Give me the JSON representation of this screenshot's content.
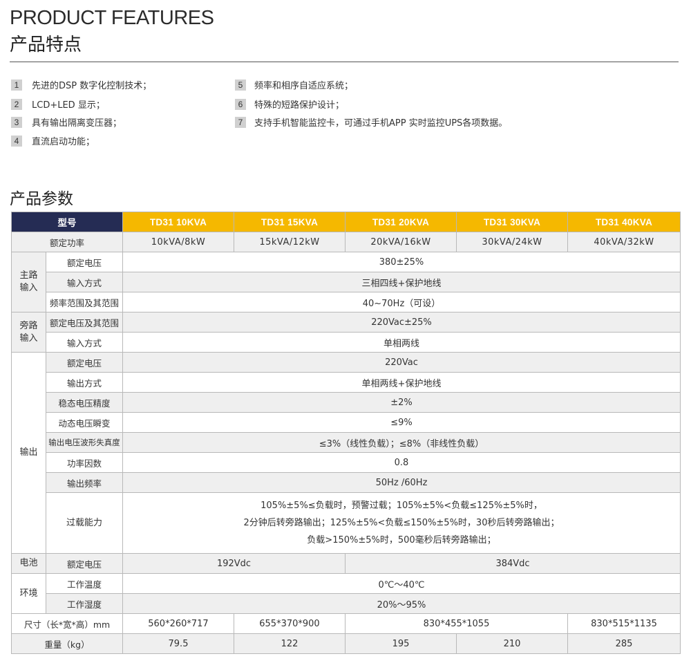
{
  "header": {
    "title_en": "PRODUCT FEATURES",
    "title_cn": "产品特点"
  },
  "features_left": [
    {
      "num": "1",
      "text": "先进的DSP 数字化控制技术；"
    },
    {
      "num": "2",
      "text": "LCD+LED 显示；"
    },
    {
      "num": "3",
      "text": "具有输出隔离变压器；"
    },
    {
      "num": "4",
      "text": "直流启动功能；"
    }
  ],
  "features_right": [
    {
      "num": "5",
      "text": "频率和相序自适应系统；"
    },
    {
      "num": "6",
      "text": "特殊的短路保护设计；"
    },
    {
      "num": "7",
      "text": "支持手机智能监控卡，可通过手机APP  实时监控UPS各项数据。"
    }
  ],
  "params_title": "产品参数",
  "table": {
    "model_label": "型号",
    "models": [
      "TD31 10KVA",
      "TD31 15KVA",
      "TD31 20KVA",
      "TD31 30KVA",
      "TD31 40KVA"
    ],
    "rated_power_label": "额定功率",
    "rated_power": [
      "10kVA/8kW",
      "15kVA/12kW",
      "20kVA/16kW",
      "30kVA/24kW",
      "40kVA/32kW"
    ],
    "main_input": {
      "group": "主路输入",
      "rows": [
        {
          "label": "额定电压",
          "value": "380±25%"
        },
        {
          "label": "输入方式",
          "value": "三相四线+保护地线"
        },
        {
          "label": "频率范围及其范围",
          "value": "40~70Hz（可设）"
        }
      ]
    },
    "bypass_input": {
      "group": "旁路输入",
      "rows": [
        {
          "label": "额定电压及其范围",
          "value": "220Vac±25%"
        },
        {
          "label": "输入方式",
          "value": "单相两线"
        }
      ]
    },
    "output": {
      "group": "输出",
      "rows": [
        {
          "label": "额定电压",
          "value": "220Vac"
        },
        {
          "label": "输出方式",
          "value": "单相两线+保护地线"
        },
        {
          "label": "稳态电压精度",
          "value": "±2%"
        },
        {
          "label": "动态电压瞬变",
          "value": "≤9%"
        },
        {
          "label": "输出电压波形失真度",
          "value": "≤3%（线性负载）；≤8%（非线性负载）"
        },
        {
          "label": "功率因数",
          "value": "0.8"
        },
        {
          "label": "输出频率",
          "value": "50Hz /60Hz"
        }
      ],
      "overload_label": "过载能力",
      "overload_lines": [
        "105%±5%≤负载时，预警过载；105%±5%<负载≤125%±5%时，",
        "2分钟后转旁路输出；125%±5%<负载≤150%±5%时，30秒后转旁路输出；",
        "负载>150%±5%时，500毫秒后转旁路输出；"
      ]
    },
    "battery": {
      "group": "电池",
      "label": "额定电压",
      "values": [
        "192Vdc",
        "384Vdc"
      ]
    },
    "environment": {
      "group": "环境",
      "rows": [
        {
          "label": "工作温度",
          "value": "0℃～40℃"
        },
        {
          "label": "工作湿度",
          "value": "20%～95%"
        }
      ]
    },
    "dimensions": {
      "label": "尺寸（长*宽*高）mm",
      "values": [
        "560*260*717",
        "655*370*900",
        "830*455*1055",
        "830*515*1135"
      ]
    },
    "weight": {
      "label": "重量（kg）",
      "values": [
        "79.5",
        "122",
        "195",
        "210",
        "285"
      ]
    }
  }
}
